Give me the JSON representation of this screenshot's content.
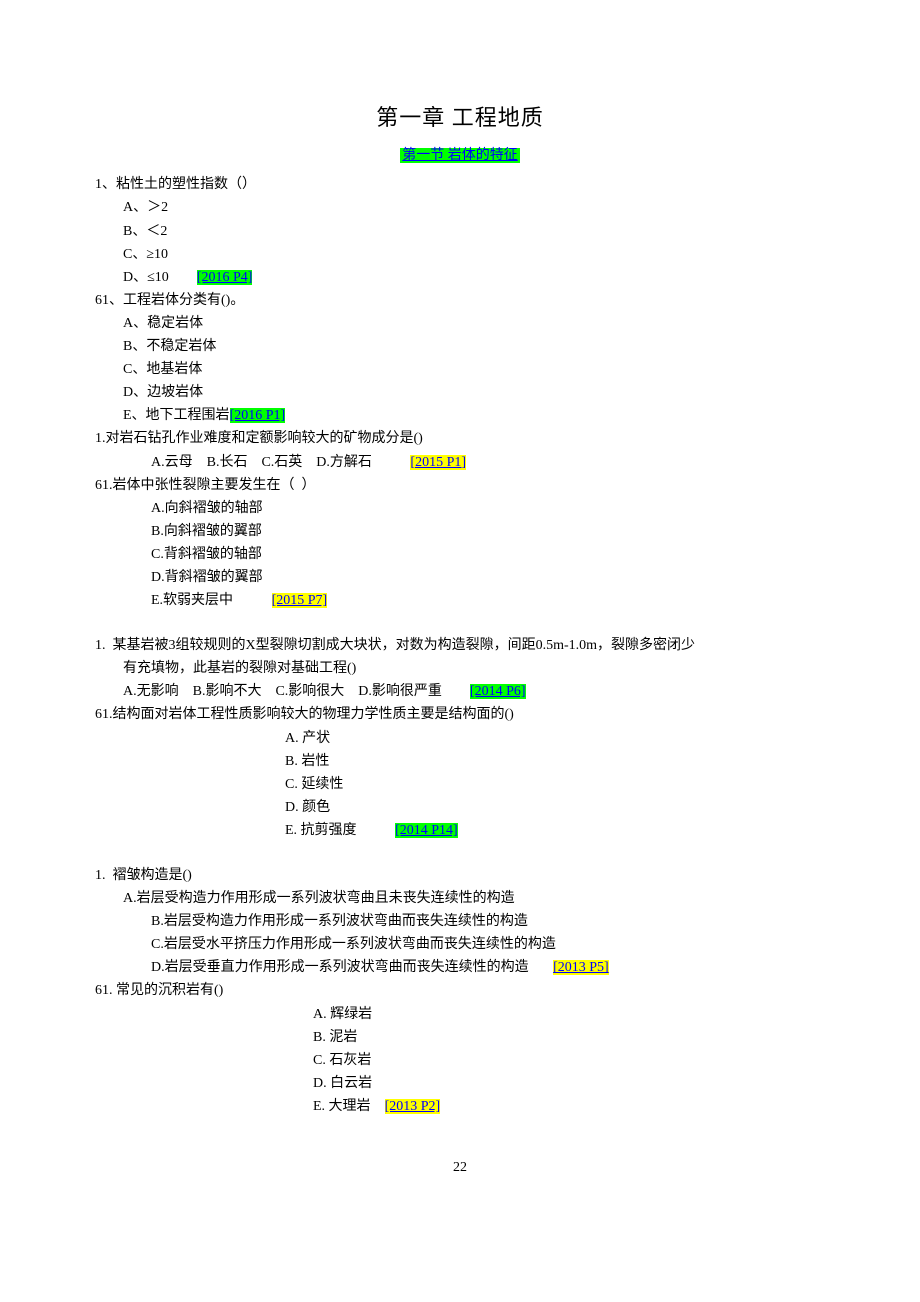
{
  "chapter_title": "第一章  工程地质",
  "section_title": "第一节 岩体的特征",
  "q1": {
    "num": "1、粘性土的塑性指数（）",
    "a": "A、＞2",
    "b": "B、＜2",
    "c": "C、≥10",
    "d": "D、≤10",
    "ref": "[2016 P4]"
  },
  "q61a": {
    "num": "61、工程岩体分类有()。",
    "a": "A、稳定岩体",
    "b": "B、不稳定岩体",
    "c": "C、地基岩体",
    "d": "D、边坡岩体",
    "e": "E、地下工程围岩",
    "ref": "[2016 P1]"
  },
  "q1b": {
    "num": "1.对岩石钻孔作业难度和定额影响较大的矿物成分是()",
    "opts": "A.云母    B.长石    C.石英    D.方解石",
    "ref": "[2015 P1]"
  },
  "q61b": {
    "num": "61.岩体中张性裂隙主要发生在（  ）",
    "a": "A.向斜褶皱的轴部",
    "b": "B.向斜褶皱的翼部",
    "c": "C.背斜褶皱的轴部",
    "d": "D.背斜褶皱的翼部",
    "e": "E.软弱夹层中",
    "ref": "[2015 P7]"
  },
  "q1c": {
    "num": "1.  某基岩被3组较规则的X型裂隙切割成大块状，对数为构造裂隙，间距0.5m-1.0m，裂隙多密闭少",
    "cont": "有充填物，此基岩的裂隙对基础工程()",
    "opts": "A.无影响    B.影响不大    C.影响很大    D.影响很严重",
    "ref": "[2014 P6]"
  },
  "q61c": {
    "num": "61.结构面对岩体工程性质影响较大的物理力学性质主要是结构面的()",
    "a": "A. 产状",
    "b": "B. 岩性",
    "c": "C. 延续性",
    "d": "D. 颜色",
    "e": "E. 抗剪强度",
    "ref": "[2014 P14]"
  },
  "q1d": {
    "num": "1.  褶皱构造是()",
    "a": "A.岩层受构造力作用形成一系列波状弯曲且未丧失连续性的构造",
    "b": "B.岩层受构造力作用形成一系列波状弯曲而丧失连续性的构造",
    "c": "C.岩层受水平挤压力作用形成一系列波状弯曲而丧失连续性的构造",
    "d": "D.岩层受垂直力作用形成一系列波状弯曲而丧失连续性的构造",
    "ref": "[2013 P5]"
  },
  "q61d": {
    "num": "61. 常见的沉积岩有()",
    "a": "A. 辉绿岩",
    "b": "B. 泥岩",
    "c": "C. 石灰岩",
    "d": "D. 白云岩",
    "e": "E. 大理岩",
    "ref": "[2013 P2]"
  },
  "page_number": "22"
}
